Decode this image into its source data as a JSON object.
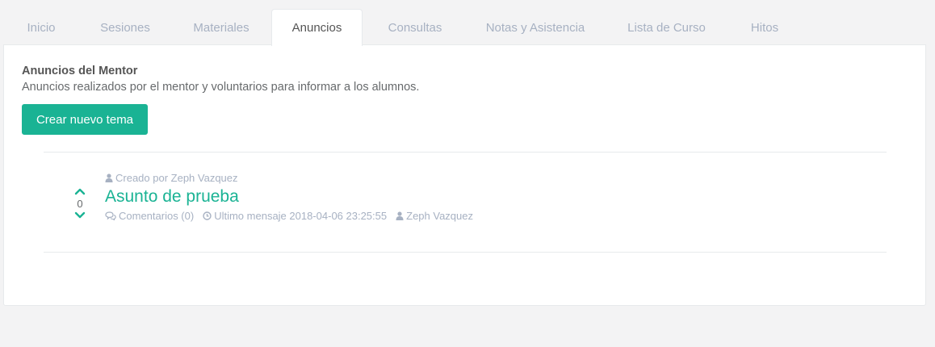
{
  "tabs": [
    {
      "label": "Inicio",
      "active": false
    },
    {
      "label": "Sesiones",
      "active": false
    },
    {
      "label": "Materiales",
      "active": false
    },
    {
      "label": "Anuncios",
      "active": true
    },
    {
      "label": "Consultas",
      "active": false
    },
    {
      "label": "Notas y Asistencia",
      "active": false
    },
    {
      "label": "Lista de Curso",
      "active": false
    },
    {
      "label": "Hitos",
      "active": false
    }
  ],
  "section": {
    "title": "Anuncios del Mentor",
    "description": "Anuncios realizados por el mentor y voluntarios para informar a los alumnos.",
    "new_button": "Crear nuevo tema"
  },
  "topic": {
    "created_by": "Creado por Zeph Vazquez",
    "title": "Asunto de prueba",
    "votes": "0",
    "comments": "Comentarios (0)",
    "last_message": "Ultimo mensaje 2018-04-06 23:25:55",
    "last_author": "Zeph Vazquez",
    "icons": {
      "user": "user-icon",
      "comments": "comments-icon",
      "clock": "clock-icon",
      "vote_up": "chevron-up-icon",
      "vote_down": "chevron-down-icon"
    }
  },
  "colors": {
    "accent": "#1ab394",
    "muted": "#a7b1c2",
    "text": "#676a6c",
    "background": "#f3f3f4"
  }
}
